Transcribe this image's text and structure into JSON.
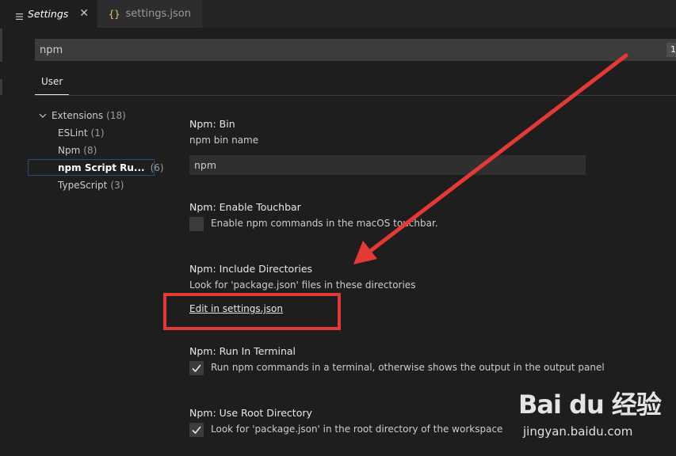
{
  "tabs": [
    {
      "label": "Settings",
      "icon": "lines-icon",
      "active": true
    },
    {
      "label": "settings.json",
      "icon": "braces-icon",
      "active": false
    }
  ],
  "search": {
    "value": "npm",
    "count": "1"
  },
  "scope": {
    "user_label": "User"
  },
  "toc": {
    "extensions": {
      "label": "Extensions",
      "count": "(18)"
    },
    "items": [
      {
        "label": "ESLint",
        "count": "(1)"
      },
      {
        "label": "Npm",
        "count": "(8)"
      },
      {
        "label": "npm Script Ru...",
        "count": "(6)"
      },
      {
        "label": "TypeScript",
        "count": "(3)"
      }
    ]
  },
  "settings": {
    "bin": {
      "prefix": "Npm: ",
      "name": "Bin",
      "desc": "npm bin name",
      "value": "npm"
    },
    "touchbar": {
      "prefix": "Npm: ",
      "name": "Enable Touchbar",
      "label": "Enable npm commands in the macOS touchbar.",
      "checked": false
    },
    "include": {
      "prefix": "Npm: ",
      "name": "Include Directories",
      "desc": "Look for 'package.json' files in these directories",
      "link": "Edit in settings.json"
    },
    "terminal": {
      "prefix": "Npm: ",
      "name": "Run In Terminal",
      "label": "Run npm commands in a terminal, otherwise shows the output in the output panel",
      "checked": true
    },
    "root": {
      "prefix": "Npm: ",
      "name": "Use Root Directory",
      "label": "Look for 'package.json' in the root directory of the workspace",
      "checked": true
    }
  },
  "colors": {
    "accent": "#e53935",
    "link": "#e7e7e7",
    "selection_border": "#264f78"
  },
  "watermark": {
    "logo": "Bai du 经验",
    "url": "jingyan.baidu.com"
  }
}
